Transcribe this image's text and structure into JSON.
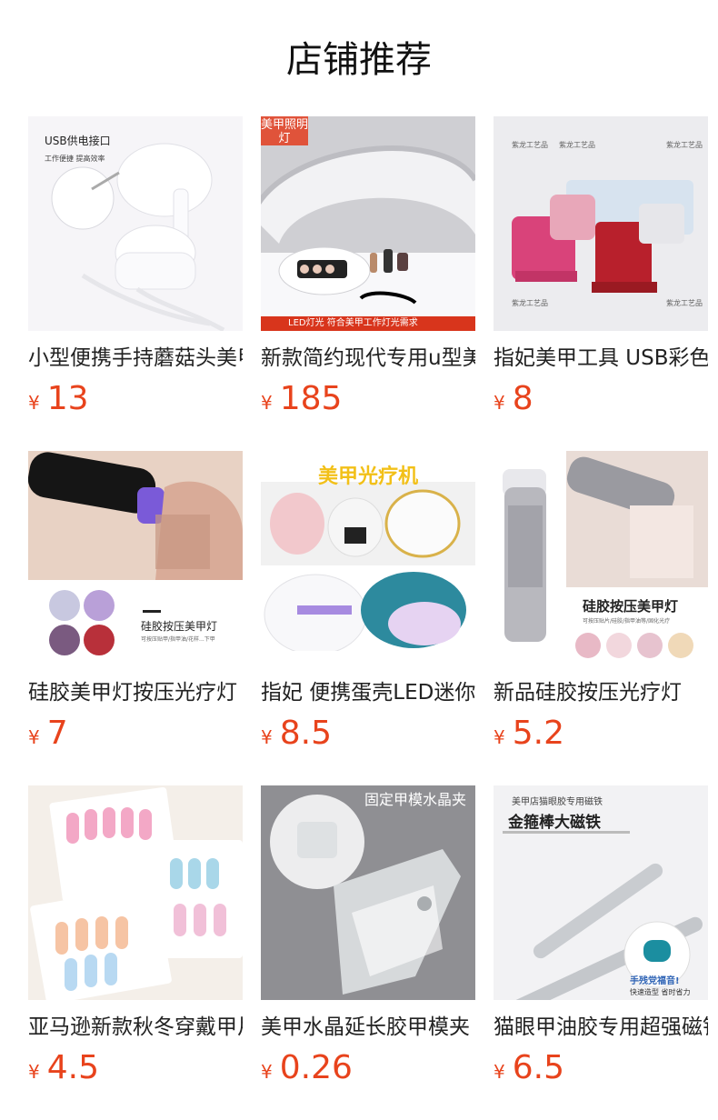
{
  "page": {
    "title": "店铺推荐"
  },
  "currency": "¥",
  "products": [
    {
      "name": "小型便携手持蘑菇头美甲灯",
      "price": "13",
      "image_text": {
        "line1": "USB供电接口",
        "line2": "工作便捷 提高效率"
      }
    },
    {
      "name": "新款简约现代专用u型美甲灯",
      "price": "185",
      "image_text": {
        "tag": "美甲照明灯",
        "banner": "LED灯光     符合美甲工作灯光需求"
      }
    },
    {
      "name": "指妃美甲工具 USB彩色迷你灯",
      "price": "8",
      "image_text": {
        "watermark": "紫龙工艺品"
      }
    },
    {
      "name": "硅胶美甲灯按压光疗灯",
      "price": "7",
      "image_text": {
        "title": "硅胶按压美甲灯",
        "sub": "可按压贴甲/指甲油/花样...下甲"
      }
    },
    {
      "name": "指妃 便携蛋壳LED迷你美甲灯",
      "price": "8.5",
      "image_text": {
        "title": "美甲光疗机"
      }
    },
    {
      "name": "新品硅胶按压光疗灯",
      "price": "5.2",
      "image_text": {
        "title": "硅胶按压美甲灯",
        "sub": "可按压贴片/硅胶/指甲油等/固化光疗"
      }
    },
    {
      "name": "亚马逊新款秋冬穿戴甲片",
      "price": "4.5",
      "image_text": {}
    },
    {
      "name": "美甲水晶延长胶甲模夹",
      "price": "0.26",
      "image_text": {
        "title": "固定甲模水晶夹"
      }
    },
    {
      "name": "猫眼甲油胶专用超强磁铁",
      "price": "6.5",
      "image_text": {
        "line1": "美甲店猫眼胶专用磁铁",
        "title": "金箍棒大磁铁",
        "badge": "手残党福音!",
        "badge_sub": "快速造型 省时省力"
      }
    }
  ]
}
